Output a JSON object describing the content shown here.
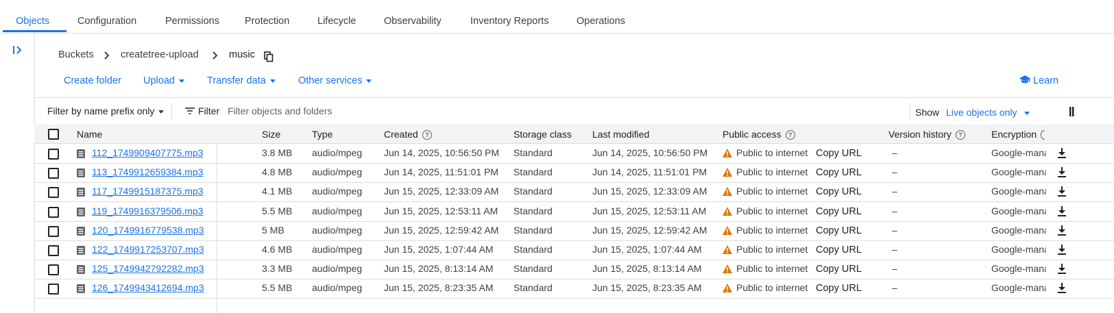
{
  "tabs": [
    {
      "label": "Objects",
      "active": true
    },
    {
      "label": "Configuration"
    },
    {
      "label": "Permissions"
    },
    {
      "label": "Protection"
    },
    {
      "label": "Lifecycle"
    },
    {
      "label": "Observability"
    },
    {
      "label": "Inventory Reports"
    },
    {
      "label": "Operations"
    }
  ],
  "breadcrumb": {
    "items": [
      "Buckets",
      "createtree-upload",
      "music"
    ],
    "icon": "copy-icon"
  },
  "actions": {
    "create_folder": "Create folder",
    "upload": "Upload",
    "transfer_data": "Transfer data",
    "other_services": "Other services",
    "learn": "Learn"
  },
  "filter": {
    "prefix_label": "Filter by name prefix only",
    "filter_label": "Filter",
    "placeholder": "Filter objects and folders",
    "show_label": "Show",
    "show_value": "Live objects only"
  },
  "columns": {
    "name": "Name",
    "size": "Size",
    "type": "Type",
    "created": "Created",
    "storage_class": "Storage class",
    "last_modified": "Last modified",
    "public_access": "Public access",
    "version_history": "Version history",
    "encryption": "Encryption"
  },
  "rows": [
    {
      "name": "112_1749909407775.mp3",
      "size": "3.8 MB",
      "type": "audio/mpeg",
      "created": "Jun 14, 2025, 10:56:50 PM",
      "storage_class": "Standard",
      "last_modified": "Jun 14, 2025, 10:56:50 PM",
      "public_access": "Public to internet",
      "copy_url": "Copy URL",
      "version_history": "–",
      "encryption": "Google-managed"
    },
    {
      "name": "113_1749912659384.mp3",
      "size": "4.8 MB",
      "type": "audio/mpeg",
      "created": "Jun 14, 2025, 11:51:01 PM",
      "storage_class": "Standard",
      "last_modified": "Jun 14, 2025, 11:51:01 PM",
      "public_access": "Public to internet",
      "copy_url": "Copy URL",
      "version_history": "–",
      "encryption": "Google-managed"
    },
    {
      "name": "117_1749915187375.mp3",
      "size": "4.1 MB",
      "type": "audio/mpeg",
      "created": "Jun 15, 2025, 12:33:09 AM",
      "storage_class": "Standard",
      "last_modified": "Jun 15, 2025, 12:33:09 AM",
      "public_access": "Public to internet",
      "copy_url": "Copy URL",
      "version_history": "–",
      "encryption": "Google-managed"
    },
    {
      "name": "119_1749916379506.mp3",
      "size": "5.5 MB",
      "type": "audio/mpeg",
      "created": "Jun 15, 2025, 12:53:11 AM",
      "storage_class": "Standard",
      "last_modified": "Jun 15, 2025, 12:53:11 AM",
      "public_access": "Public to internet",
      "copy_url": "Copy URL",
      "version_history": "–",
      "encryption": "Google-managed"
    },
    {
      "name": "120_1749916779538.mp3",
      "size": "5 MB",
      "type": "audio/mpeg",
      "created": "Jun 15, 2025, 12:59:42 AM",
      "storage_class": "Standard",
      "last_modified": "Jun 15, 2025, 12:59:42 AM",
      "public_access": "Public to internet",
      "copy_url": "Copy URL",
      "version_history": "–",
      "encryption": "Google-managed"
    },
    {
      "name": "122_1749917253707.mp3",
      "size": "4.6 MB",
      "type": "audio/mpeg",
      "created": "Jun 15, 2025, 1:07:44 AM",
      "storage_class": "Standard",
      "last_modified": "Jun 15, 2025, 1:07:44 AM",
      "public_access": "Public to internet",
      "copy_url": "Copy URL",
      "version_history": "–",
      "encryption": "Google-managed"
    },
    {
      "name": "125_1749942792282.mp3",
      "size": "3.3 MB",
      "type": "audio/mpeg",
      "created": "Jun 15, 2025, 8:13:14 AM",
      "storage_class": "Standard",
      "last_modified": "Jun 15, 2025, 8:13:14 AM",
      "public_access": "Public to internet",
      "copy_url": "Copy URL",
      "version_history": "–",
      "encryption": "Google-managed"
    },
    {
      "name": "126_1749943412694.mp3",
      "size": "5.5 MB",
      "type": "audio/mpeg",
      "created": "Jun 15, 2025, 8:23:35 AM",
      "storage_class": "Standard",
      "last_modified": "Jun 15, 2025, 8:23:35 AM",
      "public_access": "Public to internet",
      "copy_url": "Copy URL",
      "version_history": "–",
      "encryption": "Google-managed"
    }
  ],
  "colors": {
    "accent": "#1a73e8",
    "warning": "#e37400",
    "header_bg": "#f1f3f4",
    "border": "#dadce0"
  }
}
